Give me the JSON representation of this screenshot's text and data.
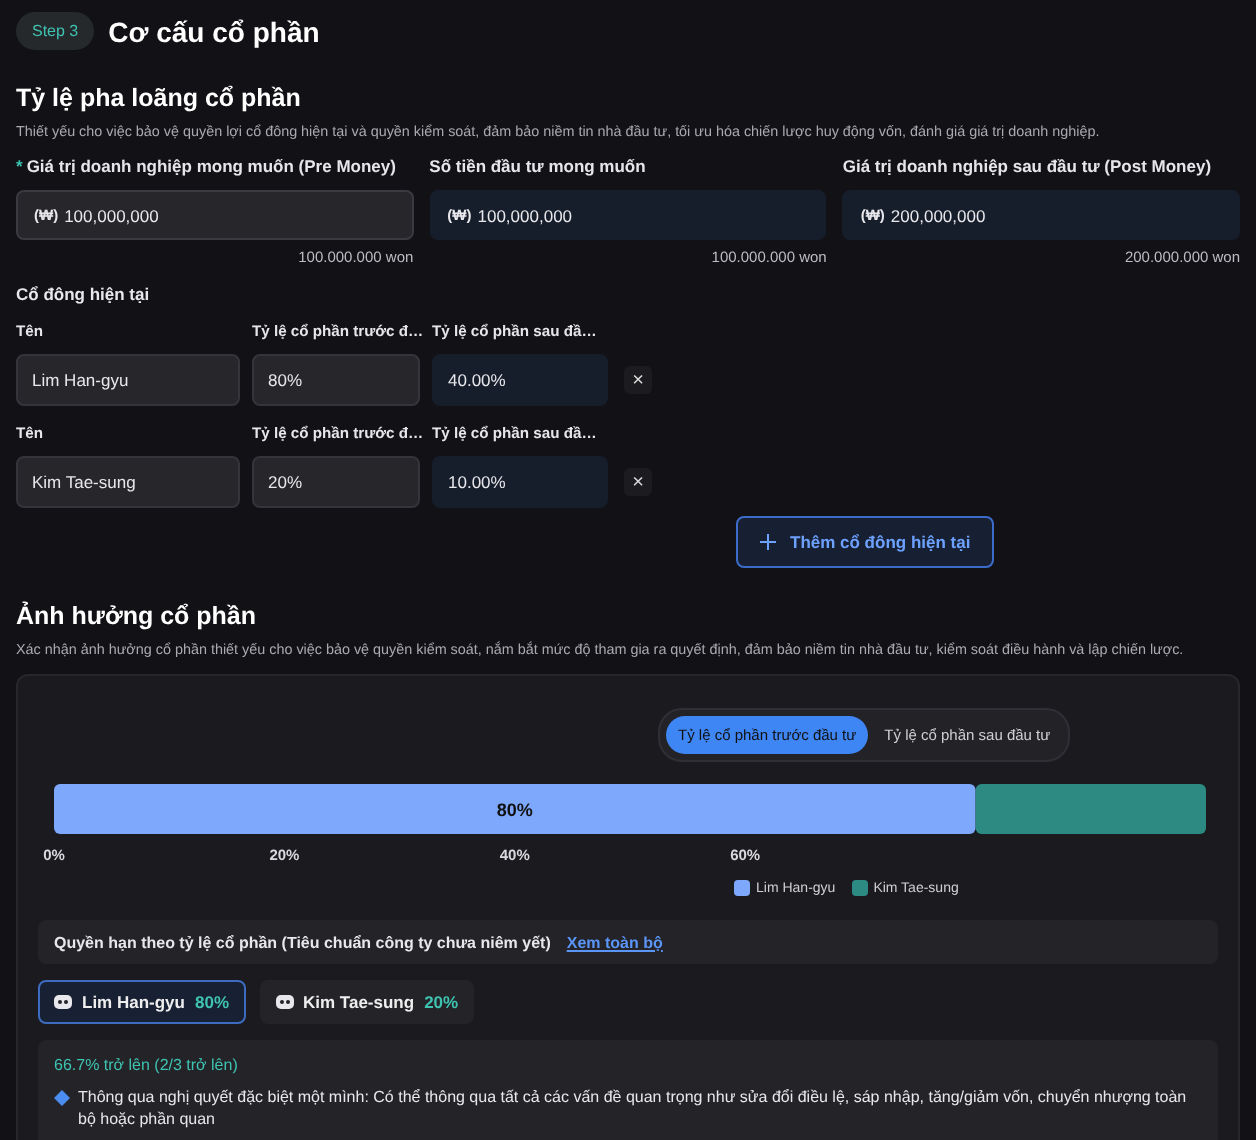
{
  "step": {
    "badge": "Step 3",
    "title": "Cơ cấu cổ phần"
  },
  "dilution": {
    "title": "Tỷ lệ pha loãng cổ phần",
    "description": "Thiết yếu cho việc bảo vệ quyền lợi cổ đông hiện tại và quyền kiểm soát, đảm bảo niềm tin nhà đầu tư, tối ưu hóa chiến lược huy động vốn, đánh giá giá trị doanh nghiệp.",
    "fields": [
      {
        "label": "Giá trị doanh nghiệp mong muốn (Pre Money)",
        "required_mark": "*",
        "prefix": "(₩)",
        "value": "100,000,000",
        "editable": true,
        "helper": "100.000.000 won"
      },
      {
        "label": "Số tiền đầu tư mong muốn",
        "prefix": "(₩)",
        "value": "100,000,000",
        "editable": false,
        "helper": "100.000.000 won"
      },
      {
        "label": "Giá trị doanh nghiệp sau đầu tư (Post Money)",
        "prefix": "(₩)",
        "value": "200,000,000",
        "editable": false,
        "helper": "200.000.000 won"
      }
    ]
  },
  "shareholders": {
    "title": "Cổ đông hiện tại",
    "rows": [
      {
        "name_label": "Tên",
        "name": "Lim Han-gyu",
        "pre_label": "Tỷ lệ cổ phần trước đ…",
        "pre": "80%",
        "post_label": "Tỷ lệ cổ phần sau đầ…",
        "post": "40.00%",
        "remove": "×"
      },
      {
        "name_label": "Tên",
        "name": "Kim Tae-sung",
        "pre_label": "Tỷ lệ cổ phần trước đ…",
        "pre": "20%",
        "post_label": "Tỷ lệ cổ phần sau đầ…",
        "post": "10.00%",
        "remove": "×"
      }
    ],
    "add_button": "Thêm cổ đông hiện tại"
  },
  "influence": {
    "title": "Ảnh hưởng cổ phần",
    "description": "Xác nhận ảnh hưởng cổ phần thiết yếu cho việc bảo vệ quyền kiểm soát, nắm bắt mức độ tham gia ra quyết định, đảm bảo niềm tin nhà đầu tư, kiểm soát điều hành và lập chiến lược.",
    "toggle": [
      {
        "label": "Tỷ lệ cổ phần trước đầu tư",
        "selected": true
      },
      {
        "label": "Tỷ lệ cổ phần sau đầu tư",
        "selected": false
      }
    ],
    "chart_data": {
      "type": "bar",
      "orientation": "horizontal",
      "stacked": true,
      "series": [
        {
          "name": "Lim Han-gyu",
          "color": "#7ea8fc",
          "values": [
            80
          ],
          "value_labels": [
            "80%"
          ]
        },
        {
          "name": "Kim Tae-sung",
          "color": "#2c8a83",
          "values": [
            20
          ]
        }
      ],
      "xlim": [
        0,
        100
      ],
      "xticks": [
        {
          "value": 0,
          "label": "0%"
        },
        {
          "value": 20,
          "label": "20%"
        },
        {
          "value": 40,
          "label": "40%"
        },
        {
          "value": 60,
          "label": "60%"
        }
      ]
    },
    "rights_bar": {
      "title": "Quyền hạn theo tỷ lệ cổ phần (Tiêu chuẩn công ty chưa niêm yết)",
      "link": "Xem toàn bộ"
    },
    "holder_chips": [
      {
        "name": "Lim Han-gyu",
        "percent": "80%",
        "selected": true
      },
      {
        "name": "Kim Tae-sung",
        "percent": "20%",
        "selected": false
      }
    ],
    "detail": {
      "threshold": "66.7% trở lên (2/3 trở lên)",
      "items": [
        "Thông qua nghị quyết đặc biệt một mình: Có thể thông qua tất cả các vấn đề quan trọng như sửa đổi điều lệ, sáp nhập, tăng/giảm vốn, chuyển nhượng toàn bộ hoặc phần quan"
      ]
    }
  }
}
